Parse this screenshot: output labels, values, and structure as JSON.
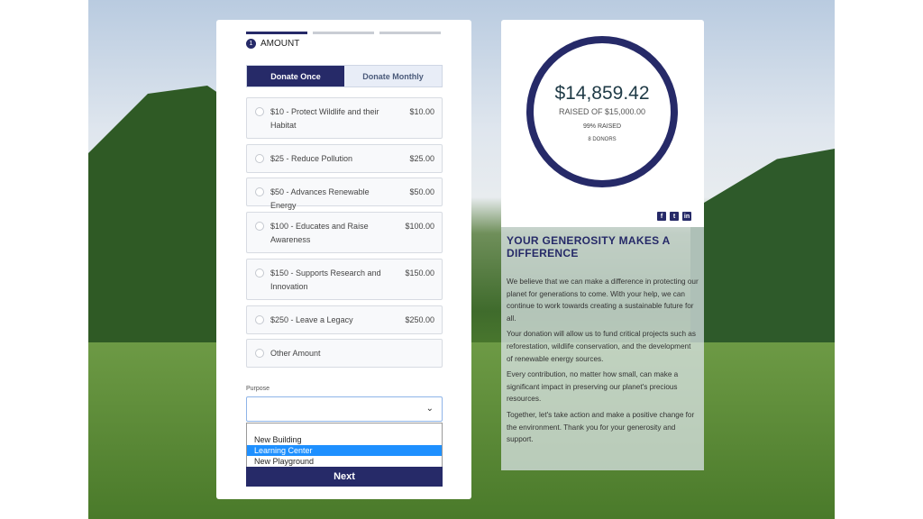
{
  "steps": {
    "current_number": "1",
    "current_label": "AMOUNT"
  },
  "frequency": {
    "once": "Donate Once",
    "monthly": "Donate Monthly",
    "selected": "once"
  },
  "options": [
    {
      "label": "$10 - Protect Wildlife and their Habitat",
      "price": "$10.00"
    },
    {
      "label": "$25 - Reduce Pollution",
      "price": "$25.00"
    },
    {
      "label": "$50 - Advances Renewable Energy",
      "price": "$50.00"
    },
    {
      "label": "$100 - Educates and Raise Awareness",
      "price": "$100.00"
    },
    {
      "label": "$150 - Supports Research and Innovation",
      "price": "$150.00"
    },
    {
      "label": "$250 - Leave a Legacy",
      "price": "$250.00"
    },
    {
      "label": "Other Amount",
      "price": ""
    }
  ],
  "purpose": {
    "label": "Purpose",
    "value": "",
    "options": [
      "New Building",
      "Learning Center",
      "New Playground"
    ],
    "highlighted": "Learning Center"
  },
  "next_label": "Next",
  "progress": {
    "raised": "$14,859.42",
    "goal_text": "RAISED OF $15,000.00",
    "percent_text": "99% RAISED",
    "percent": 99,
    "donors": "8 DONORS",
    "color": "#262a68"
  },
  "social": [
    "facebook-icon",
    "twitter-icon",
    "linkedin-icon"
  ],
  "info": {
    "title": "YOUR GENEROSITY MAKES A DIFFERENCE",
    "paragraphs": [
      "We believe that we can make a difference in protecting our planet for generations to come. With your help, we can continue to work towards creating a sustainable future for all.",
      "Your donation will allow us to fund critical projects such as reforestation, wildlife conservation, and the development of renewable energy sources.",
      "Every contribution, no matter how small, can make a significant impact in preserving our planet's precious resources.",
      "Together, let's take action and make a positive change for the environment. Thank you for your generosity and support."
    ]
  }
}
